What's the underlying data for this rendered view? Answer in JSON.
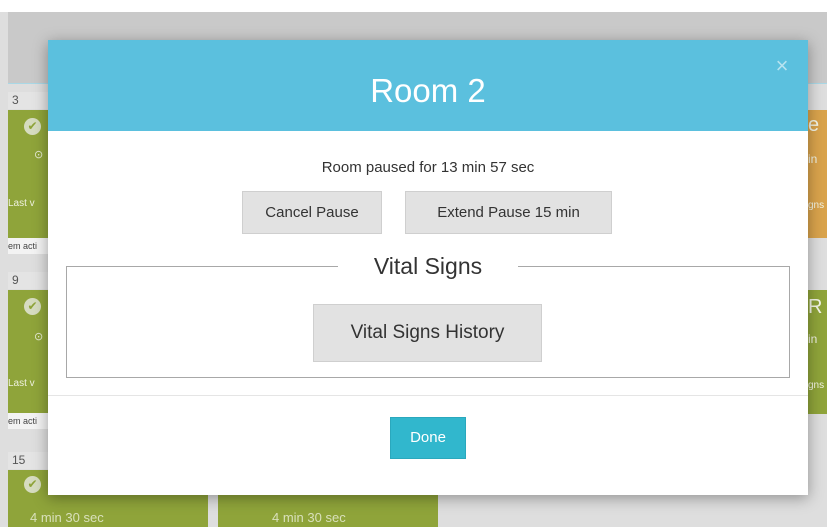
{
  "background": {
    "row_numbers": [
      "3",
      "9",
      "15"
    ],
    "last_visit_label": "Last v",
    "item_action_label": "em acti",
    "right_edge_letters": [
      "e",
      "R"
    ],
    "right_edge_small": [
      "in",
      "in"
    ],
    "right_edge_signs": [
      "gns",
      "gns"
    ],
    "tile_timers": [
      "4 min 30 sec",
      "4 min 30 sec"
    ],
    "colors": {
      "tile_green": "#8fa43a",
      "tile_orange": "#d9a34c"
    },
    "icons": {
      "check": "✔",
      "clock": "⊙"
    }
  },
  "modal": {
    "title": "Room 2",
    "close_icon": "×",
    "pause_status": "Room paused for 13 min 57 sec",
    "cancel_pause_label": "Cancel Pause",
    "extend_pause_label": "Extend Pause 15 min",
    "vital_signs_legend": "Vital Signs",
    "vital_signs_history_label": "Vital Signs History",
    "done_label": "Done",
    "colors": {
      "header": "#5bc0de",
      "done_button": "#31b7cd",
      "secondary_button": "#e2e2e2"
    }
  }
}
